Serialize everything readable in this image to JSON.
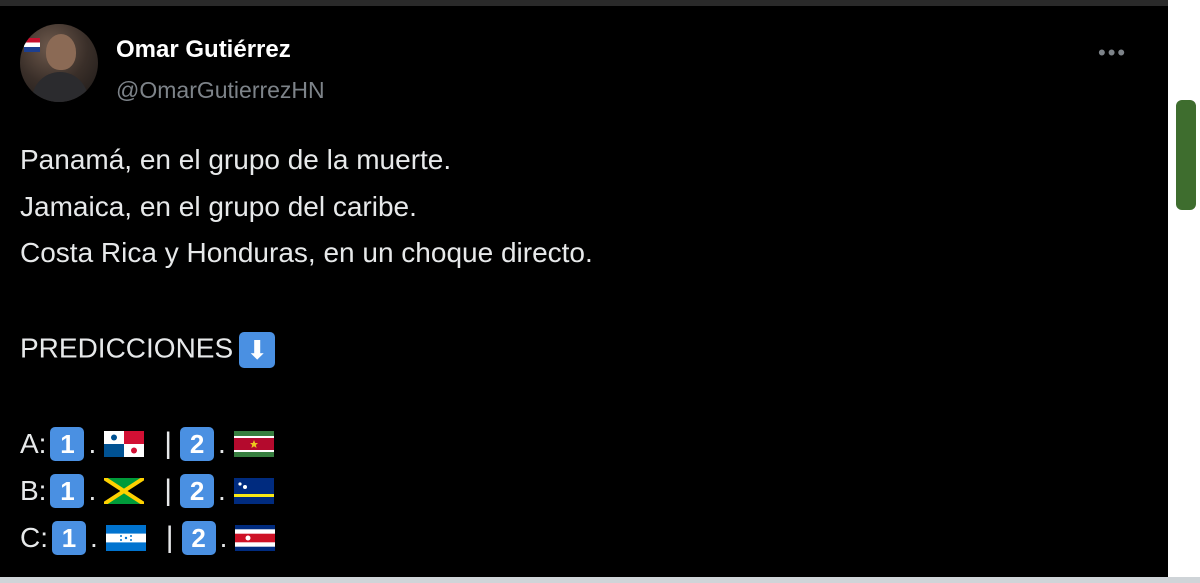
{
  "author": {
    "name": "Omar Gutiérrez",
    "handle": "@OmarGutierrezHN",
    "more_icon": "ellipsis-icon"
  },
  "tweet": {
    "lines": [
      "Panamá, en el grupo de la muerte.",
      "Jamaica, en el grupo del caribe.",
      "Costa Rica y Honduras, en un choque directo."
    ],
    "heading": "PREDICCIONES",
    "heading_icon": "down-arrow-button-icon",
    "predictions": [
      {
        "group": "A:",
        "first_num": "1",
        "first_dot": ".",
        "sep": "|",
        "second_num": "2",
        "second_dot": ".",
        "first_flag": "panama-flag-icon",
        "second_flag": "suriname-flag-icon"
      },
      {
        "group": "B:",
        "first_num": "1",
        "first_dot": ".",
        "sep": "|",
        "second_num": "2",
        "second_dot": ".",
        "first_flag": "jamaica-flag-icon",
        "second_flag": "curacao-flag-icon"
      },
      {
        "group": "C:",
        "first_num": "1",
        "first_dot": ".",
        "sep": "|",
        "second_num": "2",
        "second_dot": ".",
        "first_flag": "honduras-flag-icon",
        "second_flag": "costa-rica-flag-icon"
      }
    ]
  },
  "colors": {
    "background": "#000000",
    "text": "#e7e9ea",
    "muted": "#7d8389",
    "keycap": "#4a90e2"
  }
}
